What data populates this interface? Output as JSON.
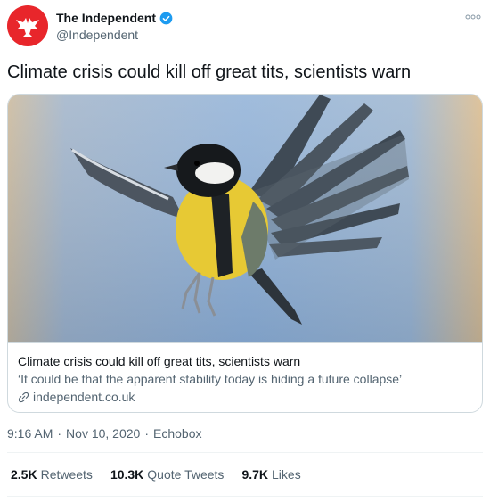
{
  "author": {
    "display_name": "The Independent",
    "handle": "@Independent"
  },
  "tweet": {
    "text": "Climate crisis could kill off great tits, scientists warn"
  },
  "card": {
    "title": "Climate crisis could kill off great tits, scientists warn",
    "description": "‘It could be that the apparent stability today is hiding a future collapse’",
    "domain": "independent.co.uk"
  },
  "meta": {
    "time": "9:16 AM",
    "dot1": "·",
    "date": "Nov 10, 2020",
    "dot2": "·",
    "source": "Echobox"
  },
  "stats": {
    "retweets_count": "2.5K",
    "retweets_label": "Retweets",
    "quotes_count": "10.3K",
    "quotes_label": "Quote Tweets",
    "likes_count": "9.7K",
    "likes_label": "Likes"
  },
  "colors": {
    "brand_red": "#e8262b",
    "verified_blue": "#1d9bf0",
    "secondary_text": "#536471"
  }
}
